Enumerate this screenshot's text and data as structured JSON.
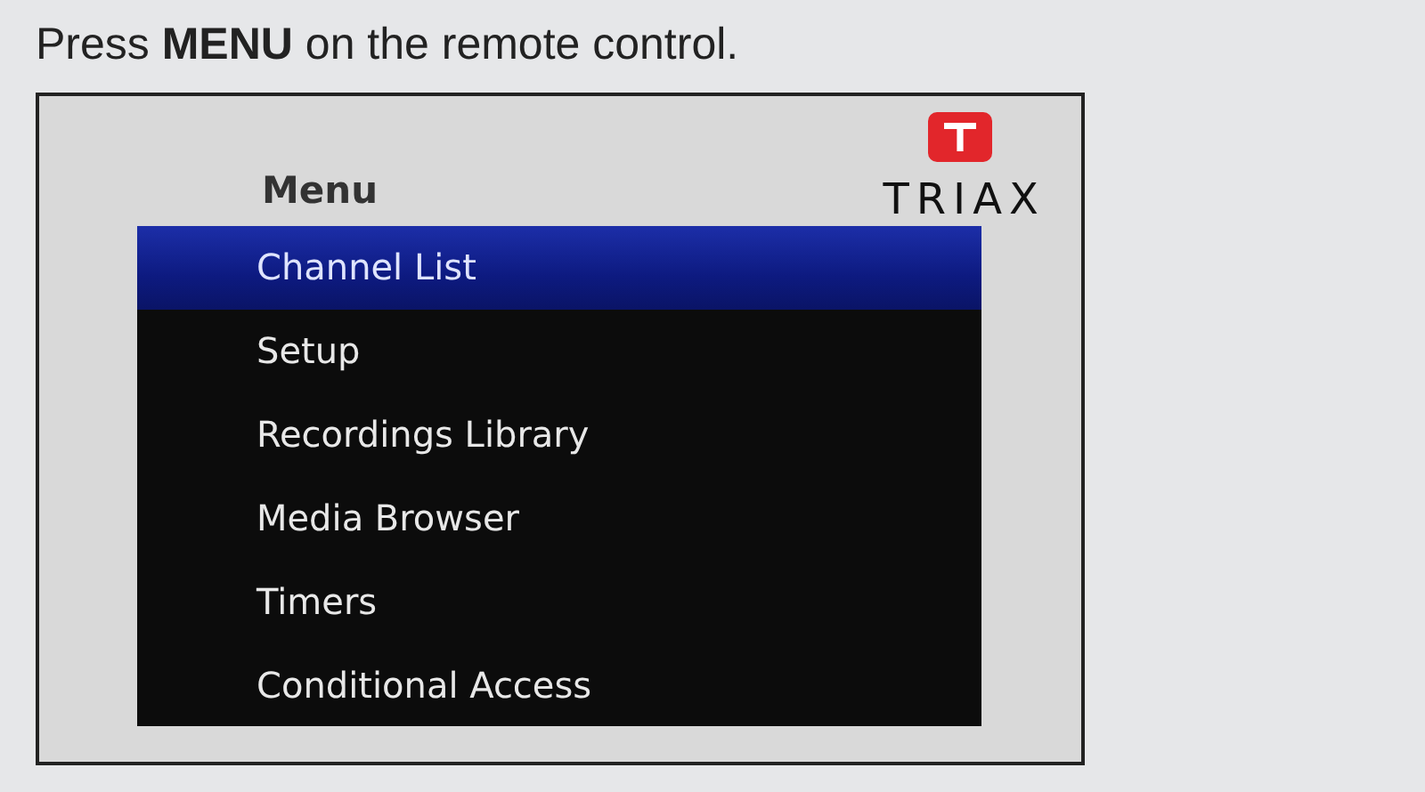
{
  "instruction": "Press **MENU** on the remote control.",
  "screen": {
    "title": "Menu",
    "brand": "TRIAX",
    "items": [
      {
        "label": "Channel List",
        "selected": true
      },
      {
        "label": "Setup",
        "selected": false
      },
      {
        "label": "Recordings Library",
        "selected": false
      },
      {
        "label": "Media Browser",
        "selected": false
      },
      {
        "label": "Timers",
        "selected": false
      },
      {
        "label": "Conditional Access",
        "selected": false
      }
    ]
  }
}
